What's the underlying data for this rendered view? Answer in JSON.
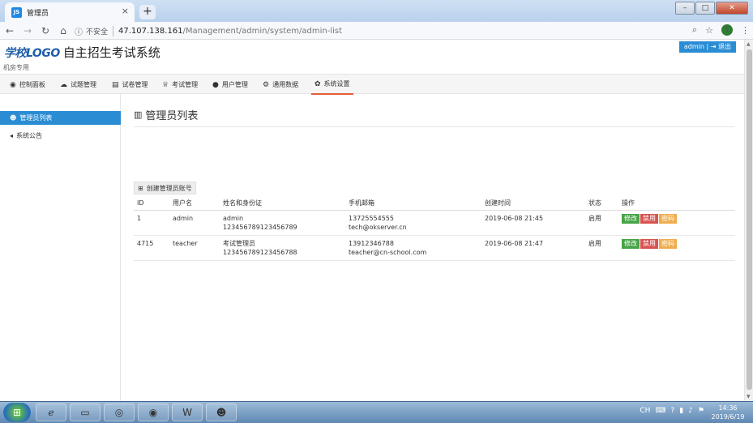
{
  "browser": {
    "tab_favicon": "JS",
    "tab_title": "管理员",
    "tab_close": "×",
    "new_tab": "+",
    "insecure_label": "不安全",
    "url_host": "47.107.138.161",
    "url_path": "/Management/admin/system/admin-list",
    "profile_initial": "I"
  },
  "header": {
    "logo_mark": "学校LOGO",
    "title": "自主招生考试系统",
    "subtitle": "机房专用",
    "user_button": "admin | ⇥ 退出"
  },
  "nav": {
    "items": [
      {
        "icon": "dashboard-icon",
        "glyph": "◉",
        "label": "控制面板"
      },
      {
        "icon": "cloud-icon",
        "glyph": "☁",
        "label": "试题管理"
      },
      {
        "icon": "document-icon",
        "glyph": "▤",
        "label": "试卷管理"
      },
      {
        "icon": "trophy-icon",
        "glyph": "♕",
        "label": "考试管理"
      },
      {
        "icon": "user-icon",
        "glyph": "●",
        "label": "用户管理"
      },
      {
        "icon": "data-icon",
        "glyph": "⚙",
        "label": "通用数据"
      },
      {
        "icon": "settings-icon",
        "glyph": "✿",
        "label": "系统设置"
      }
    ],
    "active_index": 6,
    "active_color": "#e25d3b"
  },
  "sidebar": {
    "items": [
      {
        "icon": "users-icon",
        "glyph": "☻",
        "label": "管理员列表"
      },
      {
        "icon": "megaphone-icon",
        "glyph": "◂",
        "label": "系统公告"
      }
    ],
    "active_color": "#2a8dd4"
  },
  "main": {
    "heading": "管理员列表",
    "heading_glyph": "▥",
    "create_button": "创建管理员账号",
    "table": {
      "headers": [
        "ID",
        "用户名",
        "姓名和身份证",
        "手机邮箱",
        "创建时间",
        "状态",
        "操作"
      ],
      "rows": [
        {
          "id": "1",
          "username": "admin",
          "name": "admin",
          "id_card": "123456789123456789",
          "phone": "13725554555",
          "email": "tech@okserver.cn",
          "created": "2019-06-08 21:45",
          "status": "启用"
        },
        {
          "id": "4715",
          "username": "teacher",
          "name": "考试管理员",
          "id_card": "123456789123456788",
          "phone": "13912346788",
          "email": "teacher@cn-school.com",
          "created": "2019-06-08 21:47",
          "status": "启用"
        }
      ],
      "actions": [
        "修改",
        "禁用",
        "密码"
      ]
    }
  },
  "taskbar": {
    "time": "14:36",
    "date": "2019/6/19"
  }
}
